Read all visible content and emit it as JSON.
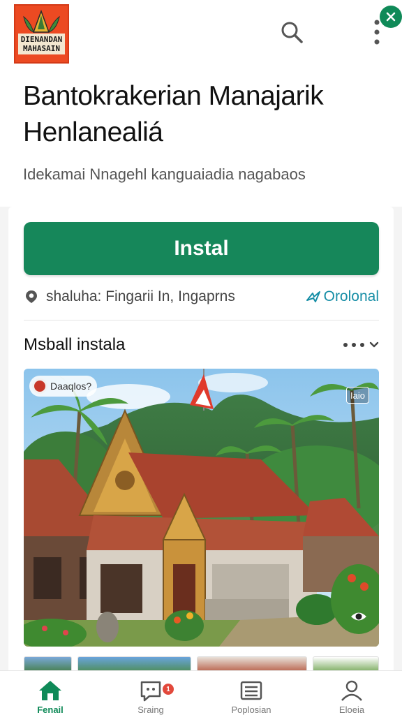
{
  "header": {
    "logo_text": "DIENANDAN\nMAHASAIN",
    "search_icon": "search-icon",
    "more_icon": "more-vertical-icon",
    "close_icon": "close-icon",
    "accent_color": "#0f8a58"
  },
  "app": {
    "title": "Bantokrakerian Manajarik Henlanealiá",
    "subtitle": "Idekamai Nnagehl kanguaiadia nagabaos"
  },
  "install": {
    "button_label": "Instal",
    "button_color": "#16875a"
  },
  "info": {
    "text": "shaluha: Fingarii In, Ingaprns",
    "optional_label": "Orolonal",
    "link_color": "#178ea6"
  },
  "section": {
    "title": "Msball instala",
    "more_icon": "more-horizontal-icon",
    "chevron_icon": "chevron-down-icon"
  },
  "screenshot": {
    "badge_left": "Daaqlos?",
    "badge_right": "Iaio",
    "eye_icon": "eye-icon"
  },
  "nav": {
    "items": [
      {
        "label": "Fenail",
        "icon": "home-icon",
        "active": true
      },
      {
        "label": "Sraing",
        "icon": "chat-icon",
        "badge": "1"
      },
      {
        "label": "Poplosian",
        "icon": "library-icon"
      },
      {
        "label": "Eloeia",
        "icon": "profile-icon"
      }
    ]
  }
}
